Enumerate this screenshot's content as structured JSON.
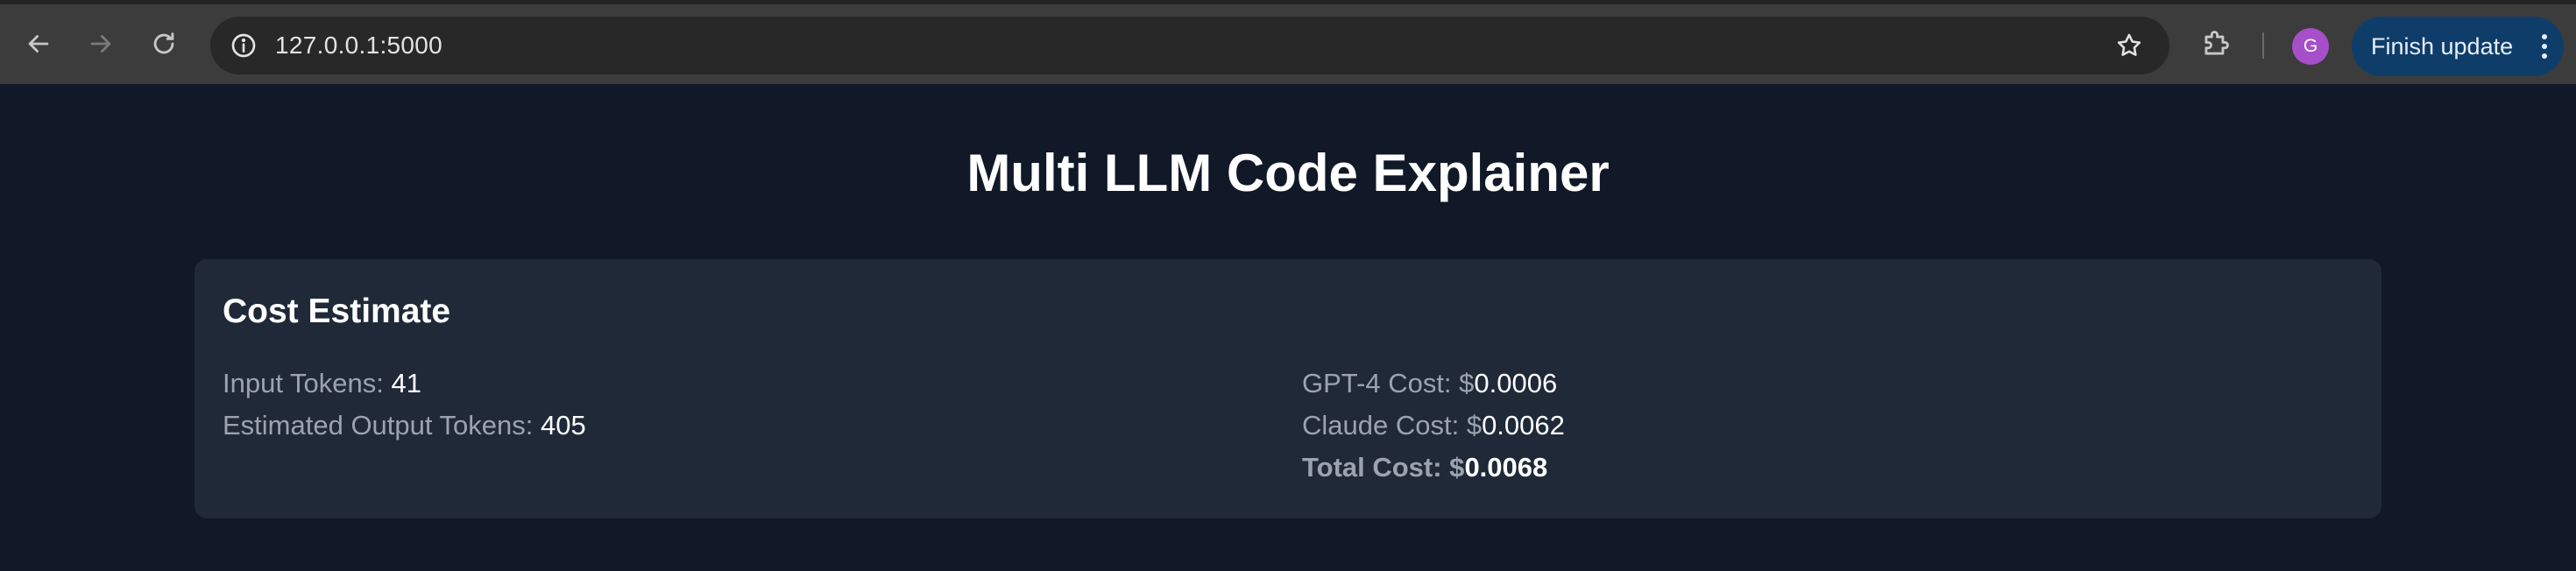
{
  "browser": {
    "url": "127.0.0.1:5000",
    "profile_initial": "G",
    "update_label": "Finish update",
    "icons": {
      "back": "arrow-left-icon",
      "forward": "arrow-right-icon",
      "reload": "reload-icon",
      "site_info": "info-icon",
      "bookmark": "star-icon",
      "extensions": "puzzle-icon",
      "menu": "kebab-menu-icon"
    },
    "colors": {
      "toolbar": "#3c3c3c",
      "omnibox": "#282828",
      "avatar": "#a64fc8",
      "update_button": "#0f3d6a"
    }
  },
  "page": {
    "title": "Multi LLM Code Explainer",
    "background": "#111827",
    "card_background": "#1f2937"
  },
  "cost_estimate": {
    "heading": "Cost Estimate",
    "input_tokens_label": "Input Tokens: ",
    "input_tokens": "41",
    "output_tokens_label": "Estimated Output Tokens: ",
    "output_tokens": "405",
    "gpt4_cost_label": "GPT-4 Cost: $",
    "gpt4_cost": "0.0006",
    "claude_cost_label": "Claude Cost: $",
    "claude_cost": "0.0062",
    "total_cost_label": "Total Cost: $",
    "total_cost": "0.0068"
  }
}
